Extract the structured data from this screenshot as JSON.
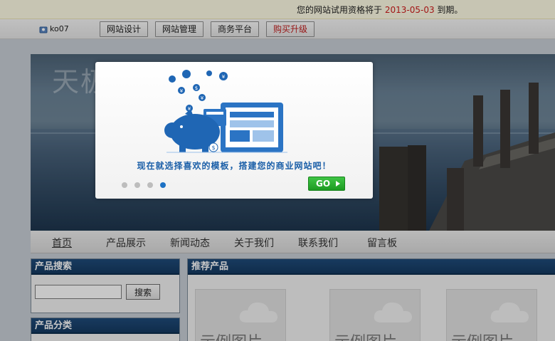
{
  "notice": {
    "prefix": "您的网站试用资格将于",
    "date": "2013-05-03",
    "suffix": "到期。"
  },
  "toolbar": {
    "username": "ko07",
    "buttons": [
      "网站设计",
      "网站管理",
      "商务平台",
      "购买升级"
    ]
  },
  "banner": {
    "title": "天极"
  },
  "nav": {
    "items": [
      "首页",
      "产品展示",
      "新闻动态",
      "关于我们",
      "联系我们",
      "留言板"
    ],
    "active_index": 0
  },
  "sidebar": {
    "search": {
      "title": "产品搜索",
      "button": "搜索",
      "input_value": ""
    },
    "category": {
      "title": "产品分类"
    }
  },
  "main": {
    "title": "推荐产品",
    "products": [
      "示例图片",
      "示例图片",
      "示例图片"
    ]
  },
  "modal": {
    "slogan": "现在就选择喜欢的模板，搭建您的商业网站吧！",
    "go_label": "GO",
    "dot_count": 4,
    "active_dot": 3
  },
  "colors": {
    "accent_blue": "#1d71c4",
    "go_green": "#1d9b22",
    "date_red": "#d01b1b",
    "box_header": "#1f4b7a"
  }
}
